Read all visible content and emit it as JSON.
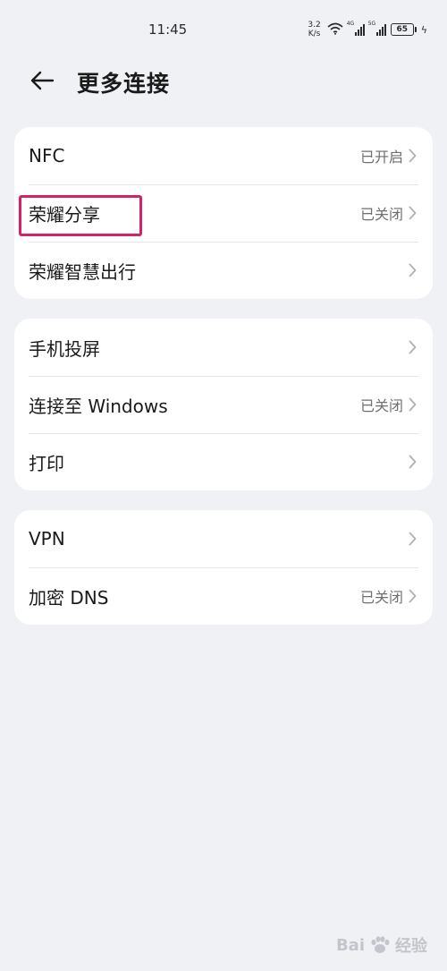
{
  "status_bar": {
    "time": "11:45",
    "net_speed_value": "3.2",
    "net_speed_unit": "K/s",
    "sim1_tag": "4G",
    "sim2_tag": "5G",
    "battery": "65"
  },
  "header": {
    "title": "更多连接"
  },
  "groups": [
    {
      "rows": [
        {
          "label": "NFC",
          "status": "已开启"
        },
        {
          "label": "荣耀分享",
          "status": "已关闭"
        },
        {
          "label": "荣耀智慧出行",
          "status": ""
        }
      ]
    },
    {
      "rows": [
        {
          "label": "手机投屏",
          "status": ""
        },
        {
          "label": "连接至 Windows",
          "status": "已关闭"
        },
        {
          "label": "打印",
          "status": ""
        }
      ]
    },
    {
      "rows": [
        {
          "label": "VPN",
          "status": ""
        },
        {
          "label": "加密 DNS",
          "status": "已关闭"
        }
      ]
    }
  ],
  "watermark": {
    "text": "Bai",
    "text2": "经验"
  },
  "colors": {
    "background": "#f0f1f5",
    "card": "#ffffff",
    "highlight": "#d4226a",
    "status_text": "#6e6e73"
  }
}
